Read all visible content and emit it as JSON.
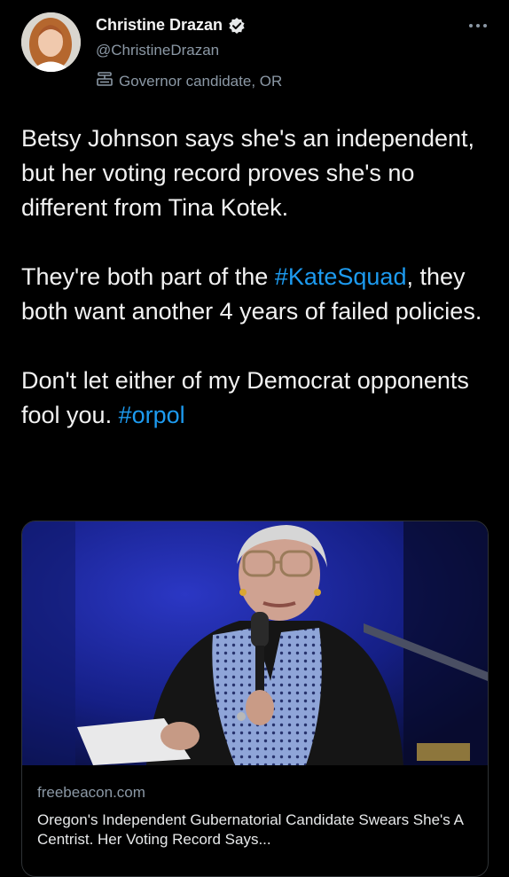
{
  "author": {
    "display_name": "Christine Drazan",
    "handle": "@ChristineDrazan",
    "affiliation": "Governor candidate, OR"
  },
  "tweet": {
    "p1": "Betsy Johnson says she's an independent, but her voting record proves she's no different from Tina Kotek.",
    "p2_before": "They're both part of the ",
    "p2_tag": "#KateSquad",
    "p2_after": ", they both want another 4 years of failed policies.",
    "p3_before": "Don't let either of my Democrat opponents fool you. ",
    "p3_tag": "#orpol"
  },
  "card": {
    "domain": "freebeacon.com",
    "title": "Oregon's Independent Gubernatorial Candidate Swears She's A Centrist. Her Voting Record Says..."
  },
  "colors": {
    "accent": "#1d9bf0",
    "background": "#000000",
    "secondary_text": "#8b98a5"
  },
  "icons": {
    "verified": "verified-badge-icon",
    "affiliation": "government-building-icon",
    "more": "more-options-icon"
  }
}
